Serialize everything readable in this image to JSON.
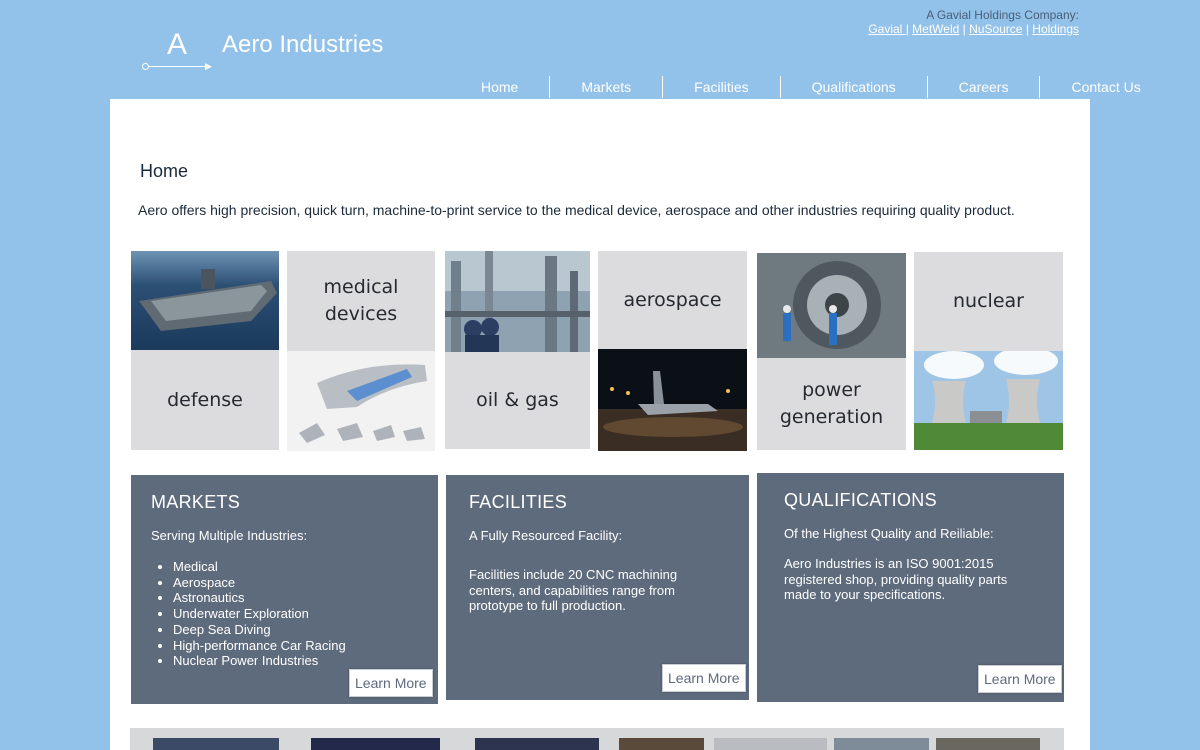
{
  "header": {
    "logo_letter": "A",
    "site_title": "Aero Industries",
    "holding_label": "A Gavial Holdings Company:",
    "holding_links": [
      "Gavial ",
      "MetWeld",
      "NuSource",
      "Holdings"
    ],
    "separators": [
      "|",
      "|",
      "|"
    ]
  },
  "nav": {
    "items": [
      "Home",
      "Markets",
      "Facilities",
      "Qualifications",
      "Careers",
      "Contact Us"
    ]
  },
  "main": {
    "page_title": "Home",
    "intro": "Aero offers high precision, quick turn, machine-to-print service to the medical device, aerospace and other industries requiring quality product.",
    "tiles": {
      "defense": "defense",
      "medical_line1": "medical",
      "medical_line2": "devices",
      "oilgas": "oil & gas",
      "aerospace": "aerospace",
      "power_line1": "power",
      "power_line2": "generation",
      "nuclear": "nuclear"
    }
  },
  "markets": {
    "title": "MARKETS",
    "subtitle": "Serving Multiple Industries:",
    "items": [
      "Medical",
      "Aerospace",
      "Astronautics",
      "Underwater Exploration",
      "Deep Sea Diving",
      "High-performance Car Racing",
      "Nuclear Power Industries"
    ],
    "button": "Learn More"
  },
  "facilities": {
    "title": "FACILITIES",
    "subtitle": "A Fully Resourced Facility:",
    "body": "Facilities include 20 CNC machining centers, and capabilities range from prototype to full production.",
    "button": "Learn More"
  },
  "qualifications": {
    "title": "QUALIFICATIONS",
    "subtitle": "Of the Highest Quality and Reiliable:",
    "body": "Aero Industries is an ISO 9001:2015 registered shop, providing quality parts made to your specifications.",
    "button": "Learn More"
  },
  "colors": {
    "background": "#92c2ea",
    "box": "#5e6b7d",
    "tile_gray": "#dcdcde"
  }
}
